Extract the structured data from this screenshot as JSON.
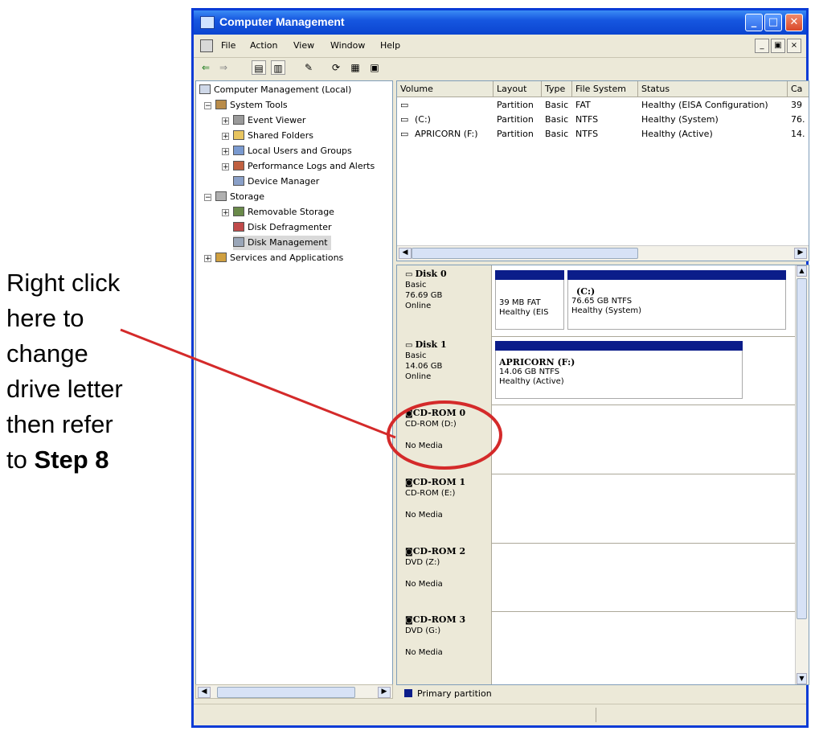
{
  "callout": {
    "lines": [
      "Right click",
      "here to",
      "change",
      "drive letter",
      "then refer"
    ],
    "last_prefix": "to",
    "last_bold": "Step 8",
    "line_color": "#d42a2a"
  },
  "window": {
    "title": "Computer Management",
    "controls": {
      "minimize": "_",
      "maximize": "□",
      "close": "✕"
    },
    "colors": {
      "titlebar": "#0b45d0",
      "partition_bar": "#0b1d8a"
    }
  },
  "menu": {
    "items": [
      "File",
      "Action",
      "View",
      "Window",
      "Help"
    ],
    "mdi": [
      "_",
      "▣",
      "×"
    ]
  },
  "toolbar": {
    "icons": [
      "back-arrow-icon",
      "forward-arrow-icon",
      "up-folder-icon",
      "show-tree-icon",
      "properties-icon",
      "refresh-icon",
      "export-icon",
      "help-icon"
    ]
  },
  "tree": {
    "root": "Computer Management (Local)",
    "system_tools": "System Tools",
    "event_viewer": "Event Viewer",
    "shared_folders": "Shared Folders",
    "local_users": "Local Users and Groups",
    "perf_logs": "Performance Logs and Alerts",
    "device_manager": "Device Manager",
    "storage": "Storage",
    "removable_storage": "Removable Storage",
    "disk_defrag": "Disk Defragmenter",
    "disk_mgmt": "Disk Management",
    "services": "Services and Applications"
  },
  "volumes": {
    "headers": [
      "Volume",
      "Layout",
      "Type",
      "File System",
      "Status",
      "Ca"
    ],
    "rows": [
      {
        "volume": "",
        "layout": "Partition",
        "type": "Basic",
        "fs": "FAT",
        "status": "Healthy (EISA Configuration)",
        "cap": "39"
      },
      {
        "volume": "(C:)",
        "layout": "Partition",
        "type": "Basic",
        "fs": "NTFS",
        "status": "Healthy (System)",
        "cap": "76."
      },
      {
        "volume": "APRICORN (F:)",
        "layout": "Partition",
        "type": "Basic",
        "fs": "NTFS",
        "status": "Healthy (Active)",
        "cap": "14."
      }
    ]
  },
  "disks": {
    "disk0": {
      "name": "Disk 0",
      "type": "Basic",
      "size": "76.69 GB",
      "state": "Online",
      "p1": {
        "size": "39 MB FAT",
        "status": "Healthy (EIS"
      },
      "p2": {
        "name": "(C:)",
        "size": "76.65 GB NTFS",
        "status": "Healthy (System)"
      }
    },
    "disk1": {
      "name": "Disk 1",
      "type": "Basic",
      "size": "14.06 GB",
      "state": "Online",
      "p1": {
        "name": "APRICORN  (F:)",
        "size": "14.06 GB NTFS",
        "status": "Healthy (Active)"
      }
    },
    "cd0": {
      "name": "CD-ROM 0",
      "drive": "CD-ROM (D:)",
      "media": "No Media"
    },
    "cd1": {
      "name": "CD-ROM 1",
      "drive": "CD-ROM (E:)",
      "media": "No Media"
    },
    "cd2": {
      "name": "CD-ROM 2",
      "drive": "DVD (Z:)",
      "media": "No Media"
    },
    "cd3": {
      "name": "CD-ROM 3",
      "drive": "DVD (G:)",
      "media": "No Media"
    }
  },
  "legend": {
    "label": "Primary partition"
  }
}
